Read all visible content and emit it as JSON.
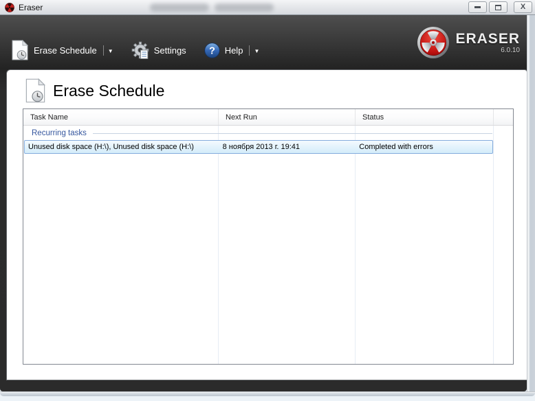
{
  "window": {
    "title": "Eraser",
    "controls": {
      "minimize": "minimize",
      "maximize": "maximize",
      "close": "close"
    }
  },
  "toolbar": {
    "items": [
      {
        "label": "Erase Schedule",
        "icon": "document-clock-icon",
        "has_dropdown": true
      },
      {
        "label": "Settings",
        "icon": "gear-document-icon",
        "has_dropdown": false
      },
      {
        "label": "Help",
        "icon": "question-circle-icon",
        "has_dropdown": true
      }
    ],
    "brand": {
      "name": "ERASER",
      "version": "6.0.10",
      "icon": "radiation-trefoil-logo"
    }
  },
  "page": {
    "title": "Erase Schedule",
    "icon": "document-clock-icon"
  },
  "table": {
    "columns": [
      "Task Name",
      "Next Run",
      "Status"
    ],
    "groups": [
      {
        "label": "Recurring tasks",
        "rows": [
          {
            "task_name": "Unused disk space (H:\\), Unused disk space (H:\\)",
            "next_run": "8 ноября 2013 г. 19:41",
            "status": "Completed with errors",
            "selected": true
          }
        ]
      }
    ]
  },
  "colors": {
    "brand_red": "#B81414",
    "toolbar_dark": "#2B2B2B",
    "group_header_blue": "#35569E",
    "selection_border": "#84ACDD",
    "selection_fill": "#D9EFFB",
    "titlebar_silver": "#E0E3E7"
  }
}
